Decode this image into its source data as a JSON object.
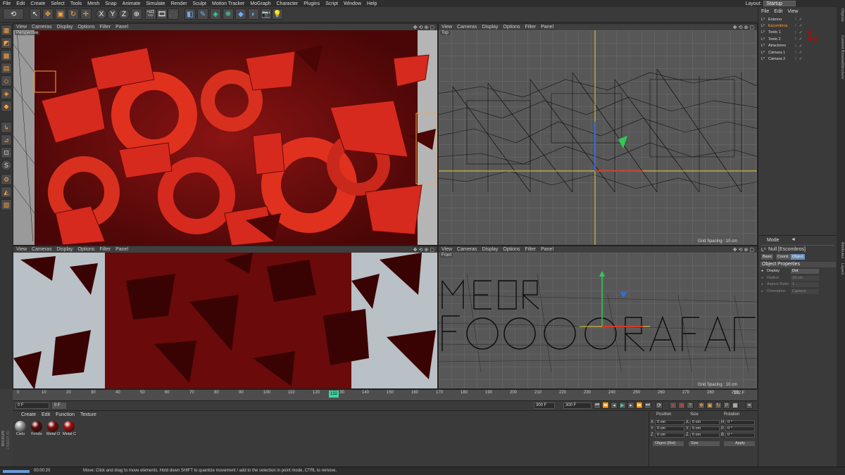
{
  "menubar": {
    "items": [
      "File",
      "Edit",
      "Create",
      "Select",
      "Tools",
      "Mesh",
      "Snap",
      "Animate",
      "Simulate",
      "Render",
      "Sculpt",
      "Motion Tracker",
      "MoGraph",
      "Character",
      "Plugins",
      "Script",
      "Window",
      "Help"
    ],
    "layout_label": "Layout:",
    "layout_value": "Startup"
  },
  "viewports": {
    "menu": [
      "View",
      "Cameras",
      "Display",
      "Options",
      "Filter",
      "Panel"
    ],
    "perspective": {
      "name": "Perspective"
    },
    "top": {
      "name": "Top",
      "grid_spacing": "Grid Spacing : 10 cm"
    },
    "front": {
      "name": "Front",
      "grid_spacing": "Grid Spacing : 10 cm"
    }
  },
  "timeline": {
    "ticks": [
      "0",
      "10",
      "20",
      "30",
      "40",
      "50",
      "60",
      "70",
      "80",
      "90",
      "100",
      "110",
      "120",
      "130",
      "140",
      "150",
      "160",
      "170",
      "180",
      "190",
      "200",
      "210",
      "220",
      "230",
      "240",
      "250",
      "260",
      "270",
      "280",
      "290"
    ],
    "current_frame": "132",
    "end_label": "132 F",
    "start_field": "0 F",
    "min_field": "0 F",
    "max_field": "300 F",
    "end_field": "300 F"
  },
  "materials": {
    "menu": [
      "Create",
      "Edit",
      "Function",
      "Texture"
    ],
    "items": [
      {
        "label": "Cielo",
        "color": "#9a9a9a"
      },
      {
        "label": "Fondo",
        "color": "#5a0a0a"
      },
      {
        "label": "Metal O",
        "color": "#7a0a0a"
      },
      {
        "label": "Metal C",
        "color": "#9c0d0d"
      }
    ]
  },
  "coords": {
    "headers": {
      "position": "Position",
      "size": "Size",
      "rotation": "Rotation"
    },
    "rows": [
      {
        "axis": "X",
        "pos": "0 cm",
        "size": "0 cm",
        "raxis": "H",
        "rot": "0 °"
      },
      {
        "axis": "Y",
        "pos": "0 cm",
        "size": "0 cm",
        "raxis": "P",
        "rot": "0 °"
      },
      {
        "axis": "Z",
        "pos": "0 cm",
        "size": "0 cm",
        "raxis": "B",
        "rot": "0 °"
      }
    ],
    "mode_select": "Object (Rel)",
    "size_select": "Size",
    "apply": "Apply"
  },
  "objects": {
    "menu": [
      "File",
      "Edit",
      "View"
    ],
    "items": [
      {
        "name": "Entorno",
        "selected": false
      },
      {
        "name": "Escombros",
        "selected": true
      },
      {
        "name": "Texto 1",
        "selected": false
      },
      {
        "name": "Texto 2",
        "selected": false
      },
      {
        "name": "Atractores",
        "selected": false
      },
      {
        "name": "Cámara 1",
        "selected": false
      },
      {
        "name": "Cámara 2",
        "selected": false
      }
    ]
  },
  "attributes": {
    "mode": "Mode",
    "object_title": "Null [Escombros]",
    "tabs": [
      "Basic",
      "Coord.",
      "Object"
    ],
    "section": "Object Properties",
    "props": [
      {
        "label": "Display",
        "value": "Dot"
      },
      {
        "label": "Radius",
        "value": "10 cm"
      },
      {
        "label": "Aspect Ratio",
        "value": "1"
      },
      {
        "label": "Orientation",
        "value": "Camera"
      }
    ]
  },
  "sidetabs": [
    "Objects",
    "Content Browser",
    "Structure",
    "Attributes",
    "Layers"
  ],
  "status": {
    "time": "00:00:20",
    "message": "Move: Click and drag to move elements. Hold down SHIFT to quantize movement / add to the selection in point mode, CTRL to remove."
  },
  "branding": {
    "line1": "MAXON",
    "line2": "CINEMA 4D"
  },
  "colors": {
    "accent": "#ffa43a",
    "render_red": "#c0201b",
    "wire_axis_y": "#e8d23a",
    "wire_axis_x": "#d83a2a",
    "axis_z": "#3a6ad8",
    "axis_green": "#2ecc55"
  }
}
